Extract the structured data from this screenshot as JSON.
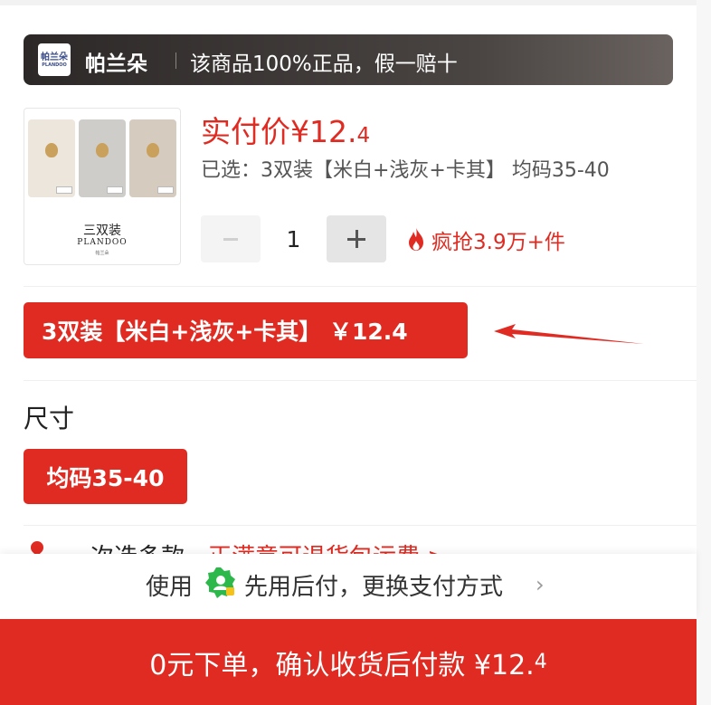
{
  "banner": {
    "logo_text": "帕兰朵",
    "logo_subtext": "PLANDOO",
    "brand": "帕兰朵",
    "slogan": "该商品100%正品，假一赔十"
  },
  "product": {
    "image": {
      "pack_title": "三双装",
      "pack_brand": "PLANDOO",
      "pack_sub": "帕兰朵"
    },
    "price_label": "实付价¥12.",
    "price_decimal": "4",
    "selected": "已选：3双装【米白+浅灰+卡其】 均码35-40",
    "quantity": "1",
    "hot_sale": "疯抢3.9万+件"
  },
  "variant": {
    "selected_label": "3双装【米白+浅灰+卡其】 ￥12.4"
  },
  "size": {
    "heading": "尺寸",
    "selected": "均码35-40"
  },
  "shipping_row": {
    "text": "次选多款，",
    "link": "正满意可退货包运费 >"
  },
  "payment": {
    "prefix": "使用",
    "text": "先用后付，更换支付方式",
    "chevron": "›"
  },
  "order_button": {
    "label": "0元下单，确认收货后付款 ¥12.",
    "decimal": "4"
  },
  "colors": {
    "accent": "#e02b22",
    "banner_dark": "#2c2827",
    "pay_green": "#2db84b"
  },
  "icons": {
    "minus": "minus-icon",
    "plus": "plus-icon",
    "flame": "flame-icon",
    "pay": "shield-user-icon",
    "arrow": "pointer-arrow-icon"
  }
}
